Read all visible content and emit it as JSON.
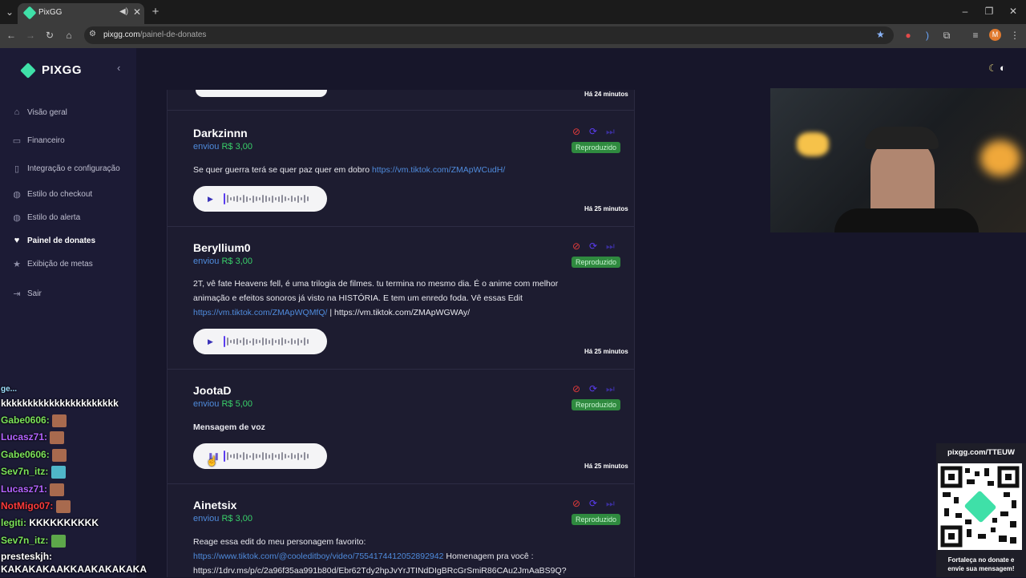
{
  "browser": {
    "tab_title": "PixGG",
    "url_domain": "pixgg.com",
    "url_path": "/painel-de-donates",
    "profile_initial": "M"
  },
  "sidebar": {
    "logo": "PIXGG",
    "items": [
      {
        "label": "Visão geral",
        "icon": "home-icon"
      },
      {
        "label": "Financeiro",
        "icon": "wallet-icon"
      },
      {
        "label": "Integração e configuração",
        "icon": "puzzle-icon"
      },
      {
        "label": "Estilo do checkout",
        "icon": "palette-icon"
      },
      {
        "label": "Estilo do alerta",
        "icon": "palette-icon"
      },
      {
        "label": "Painel de donates",
        "icon": "donate-icon",
        "active": true
      },
      {
        "label": "Exibição de metas",
        "icon": "star-icon"
      },
      {
        "label": "Sair",
        "icon": "logout-icon"
      }
    ]
  },
  "donations": [
    {
      "time": "Há 24 minutos"
    },
    {
      "name": "Darkzinnn",
      "sent": "enviou",
      "amount": "R$ 3,00",
      "status": "Reproduzido",
      "message": "Se quer guerra terá se quer paz quer em dobro ",
      "link1": "https://vm.tiktok.com/ZMApWCudH/",
      "time": "Há 25 minutos"
    },
    {
      "name": "Beryllium0",
      "sent": "enviou",
      "amount": "R$ 3,00",
      "status": "Reproduzido",
      "message_l1": "2T, vê fate Heavens fell, é uma trilogia de filmes. tu termina no mesmo dia. É o anime com melhor",
      "message_l2": "animação e efeitos sonoros já visto na HISTÓRIA. E tem um enredo foda. Vê essas Edit",
      "link1": "https://vm.tiktok.com/ZMApWQMfQ/",
      "link2": " | https://vm.tiktok.com/ZMApWGWAy/",
      "time": "Há 25 minutos"
    },
    {
      "name": "JootaD",
      "sent": "enviou",
      "amount": "R$ 5,00",
      "status": "Reproduzido",
      "message": "Mensagem de voz",
      "time": "Há 25 minutos"
    },
    {
      "name": "Ainetsix",
      "sent": "enviou",
      "amount": "R$ 3,00",
      "status": "Reproduzido",
      "message": "Reage essa edit do meu personagem favorito:",
      "link1": "https://www.tiktok.com/@cooleditboy/video/7554174412052892942",
      "after_link": " Homenagem pra você :",
      "line3": "https://1drv.ms/p/c/2a96f35aa991b80d/Ebr62Tdy2hpJvYrJTINdDIgBRcGrSmiR86CAu2JmAaBS9Q?"
    }
  ],
  "chat": [
    {
      "user": "",
      "text": "kkkkkkkkkkkkkkkkkkkkkk",
      "color": "#9fe0ff"
    },
    {
      "user": "Gabe0606:",
      "text": "",
      "color": "#7ce35a",
      "emote": true
    },
    {
      "user": "Lucasz71:",
      "text": "",
      "color": "#b463ff",
      "emote": true
    },
    {
      "user": "Gabe0606:",
      "text": "",
      "color": "#7ce35a",
      "emote": true
    },
    {
      "user": "Sev7n_itz:",
      "text": "",
      "color": "#7ce35a",
      "emote": true
    },
    {
      "user": "Lucasz71:",
      "text": "",
      "color": "#b463ff",
      "emote": true
    },
    {
      "user": "NotMigo07:",
      "text": "",
      "color": "#ff3b3b",
      "emote": true
    },
    {
      "user": "legiti:",
      "text": " KKKKKKKKKK",
      "color": "#7ce35a"
    },
    {
      "user": "Sev7n_itz:",
      "text": "",
      "color": "#7ce35a",
      "emote": true
    },
    {
      "user": "presteskjh:",
      "text": "",
      "color": "#ffffff"
    },
    {
      "user": "",
      "text": "KAKAKAKAAKKAAKAKAKAKA",
      "color": "#ffffff"
    }
  ],
  "qr": {
    "url": "pixgg.com/TTEUW",
    "caption_l1": "Fortaleça no donate e",
    "caption_l2": "envie sua mensagem!"
  },
  "colors": {
    "accent": "#4f8bdc",
    "amount": "#39d06a",
    "badge": "#2f8a3f",
    "sidebar": "#1c1b35"
  }
}
